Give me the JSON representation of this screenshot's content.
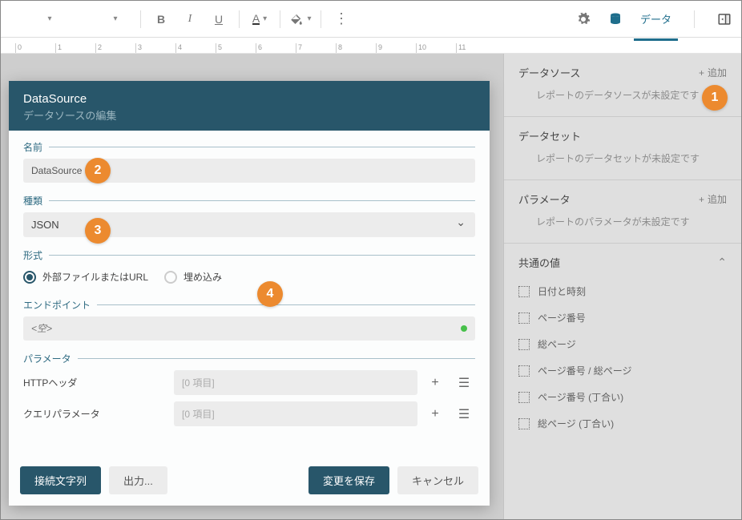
{
  "toolbar": {
    "data_tab": "データ"
  },
  "ruler": [
    "0",
    "1",
    "2",
    "3",
    "4",
    "5",
    "6",
    "7",
    "8",
    "9",
    "10",
    "11"
  ],
  "side": {
    "datasource": {
      "title": "データソース",
      "add": "追加",
      "empty": "レポートのデータソースが未設定です"
    },
    "dataset": {
      "title": "データセット",
      "empty": "レポートのデータセットが未設定です"
    },
    "param": {
      "title": "パラメータ",
      "add": "追加",
      "empty": "レポートのパラメータが未設定です"
    },
    "common": {
      "title": "共通の値",
      "items": [
        "日付と時刻",
        "ページ番号",
        "総ページ",
        "ページ番号 / 総ページ",
        "ページ番号 (丁合い)",
        "総ページ (丁合い)"
      ]
    }
  },
  "modal": {
    "title": "DataSource",
    "subtitle": "データソースの編集",
    "name_label": "名前",
    "name_value": "DataSource",
    "type_label": "種類",
    "type_value": "JSON",
    "format_label": "形式",
    "format_opt_external": "外部ファイルまたはURL",
    "format_opt_embed": "埋め込み",
    "endpoint_label": "エンドポイント",
    "endpoint_placeholder": "<空>",
    "param_label": "パラメータ",
    "http_header": "HTTPヘッダ",
    "query_param": "クエリパラメータ",
    "items_zero": "[0 項目]",
    "btn_conn": "接続文字列",
    "btn_export": "出力...",
    "btn_save": "変更を保存",
    "btn_cancel": "キャンセル"
  },
  "callouts": {
    "c1": "1",
    "c2": "2",
    "c3": "3",
    "c4": "4"
  }
}
